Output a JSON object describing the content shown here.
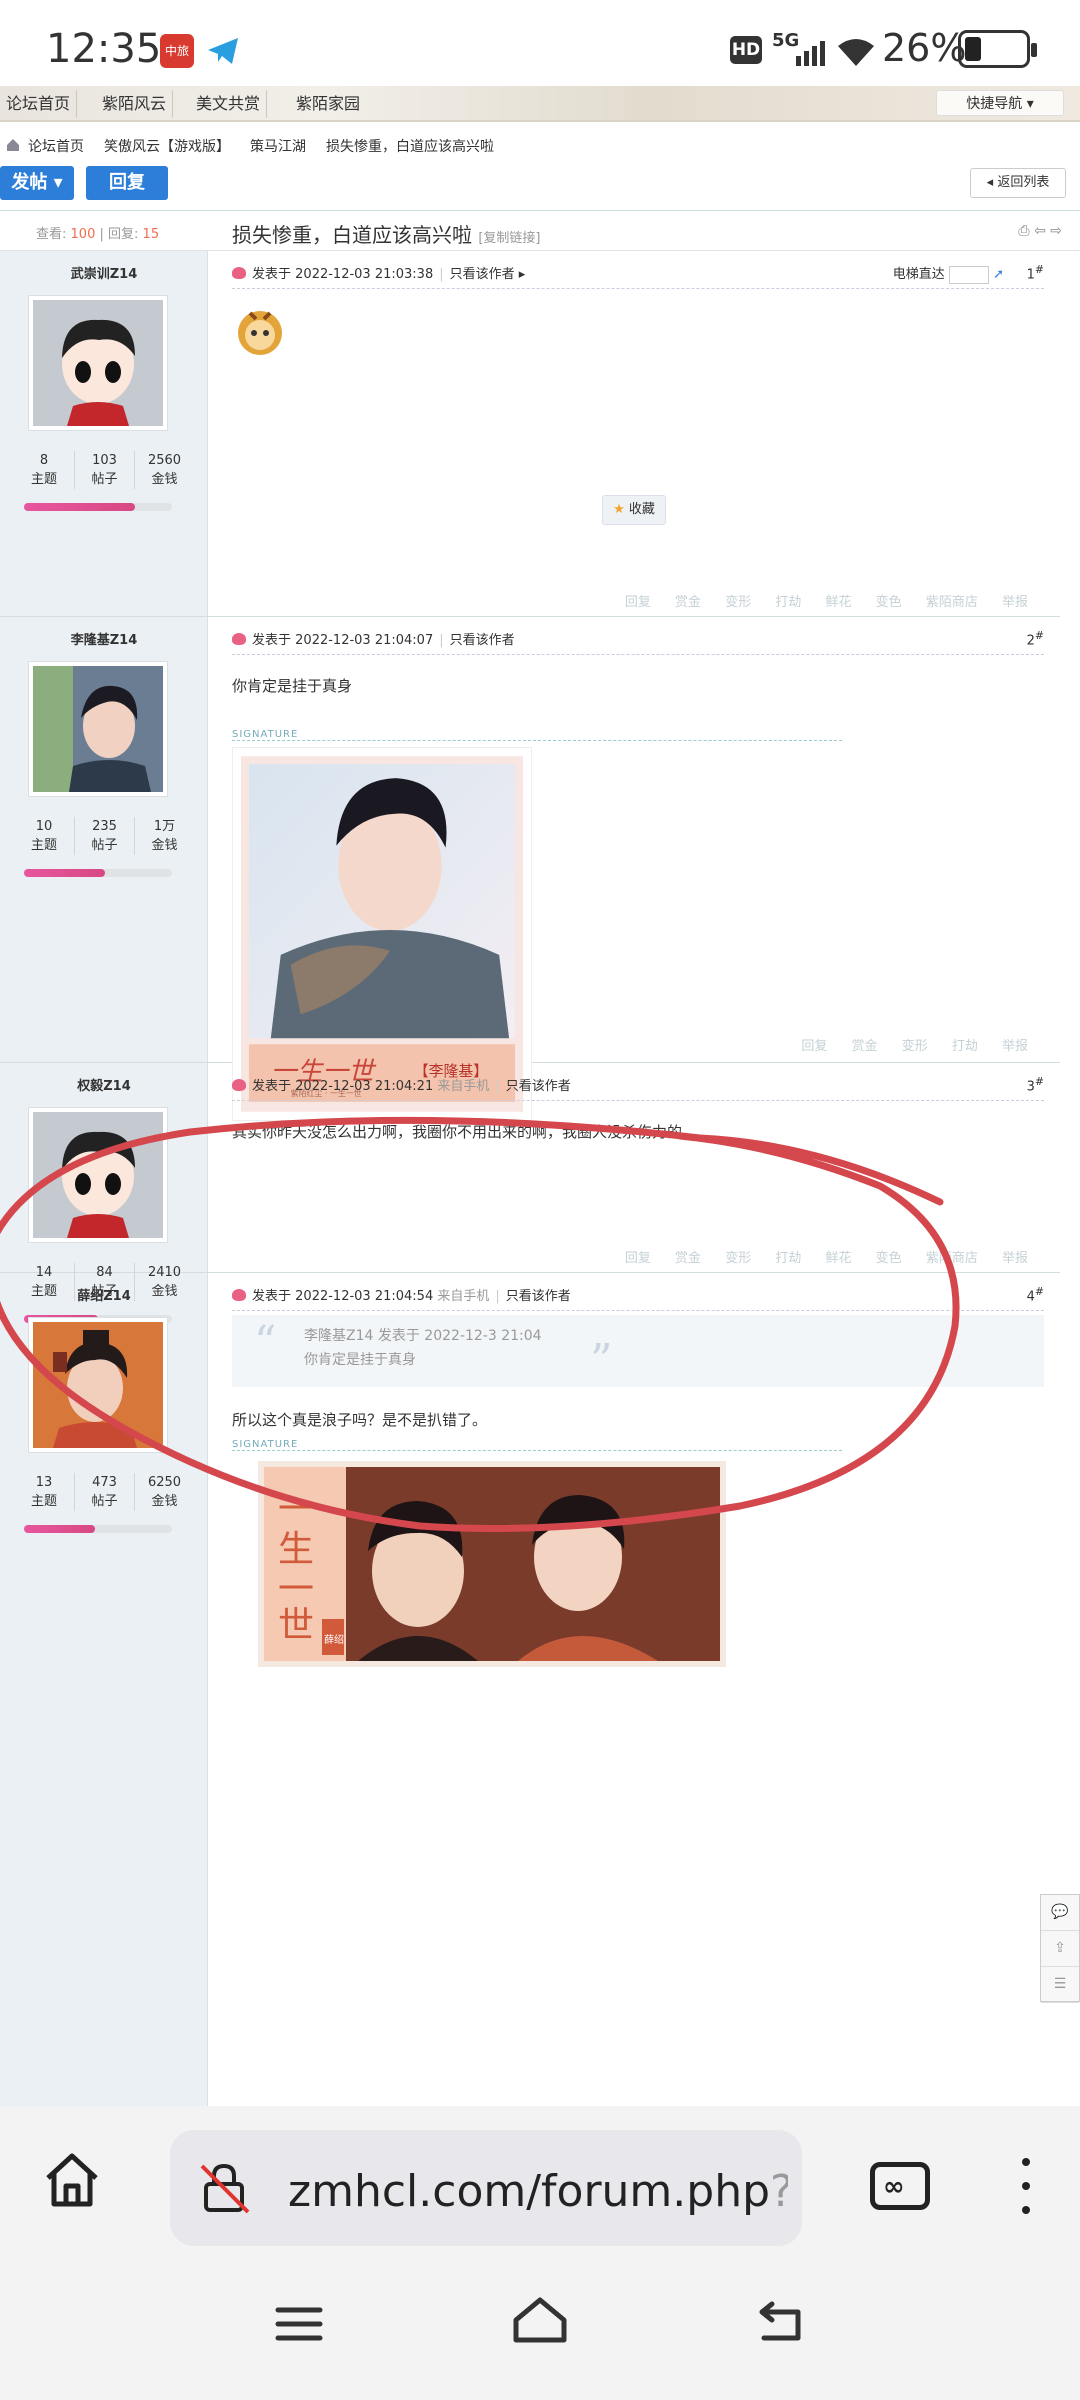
{
  "status": {
    "time": "12:35",
    "app1": "中旅",
    "hd": "HD",
    "signal": "5G",
    "battery": "26%"
  },
  "nav": {
    "items": [
      "论坛首页",
      "紫陌风云",
      "美文共赏",
      "紫陌家园"
    ],
    "quick": "快捷导航"
  },
  "breadcrumb": [
    "论坛首页",
    "笑傲风云【游戏版】",
    "策马江湖",
    "损失惨重，白道应该高兴啦"
  ],
  "toolbar": {
    "post": "发帖",
    "reply": "回复",
    "back": "返回列表"
  },
  "thread": {
    "views_label": "查看:",
    "views": "100",
    "replies_label": "回复:",
    "replies": "15",
    "title": "损失惨重，白道应该高兴啦",
    "copy_link": "[复制链接]"
  },
  "labels": {
    "posted": "发表于",
    "only_author": "只看该作者",
    "from_mobile": "来自手机",
    "elevator": "电梯直达",
    "favorite": "收藏",
    "signature": "SIGNATURE",
    "topics": "主题",
    "posts": "帖子",
    "money": "金钱"
  },
  "actions": [
    "回复",
    "赏金",
    "变形",
    "打劫",
    "鲜花",
    "变色",
    "紫陌商店",
    "举报"
  ],
  "actions_short": [
    "回复",
    "赏金",
    "变形",
    "打劫",
    "举报"
  ],
  "posts": [
    {
      "author": "武崇训Z14",
      "date": "2022-12-03 21:03:38",
      "floor": "1",
      "topics": "8",
      "posts": "103",
      "money": "2560",
      "level": 0.75
    },
    {
      "author": "李隆基Z14",
      "date": "2022-12-03 21:04:07",
      "floor": "2",
      "topics": "10",
      "posts": "235",
      "money": "1万",
      "level": 0.55,
      "content": "你肯定是挂于真身",
      "sig_name": "【李隆基】",
      "sig_sub": "紫陌红尘 · 一生一世"
    },
    {
      "author": "权毅Z14",
      "date": "2022-12-03 21:04:21",
      "floor": "3",
      "topics": "14",
      "posts": "84",
      "money": "2410",
      "level": 0.5,
      "content": "其实你昨天没怎么出力啊，我圈你不用出来的啊，我圈人没杀伤力的"
    },
    {
      "author": "薛绍Z14",
      "date": "2022-12-03 21:04:54",
      "floor": "4",
      "topics": "13",
      "posts": "473",
      "money": "6250",
      "level": 0.48,
      "quote_head": "李隆基Z14 发表于 2022-12-3 21:04",
      "quote_body": "你肯定是挂于真身",
      "content": "所以这个真是浪子吗？是不是扒错了。",
      "sig_name": "薛绍"
    }
  ],
  "browser": {
    "url": "zmhcl.com/forum.php",
    "url_rest": "?m"
  }
}
